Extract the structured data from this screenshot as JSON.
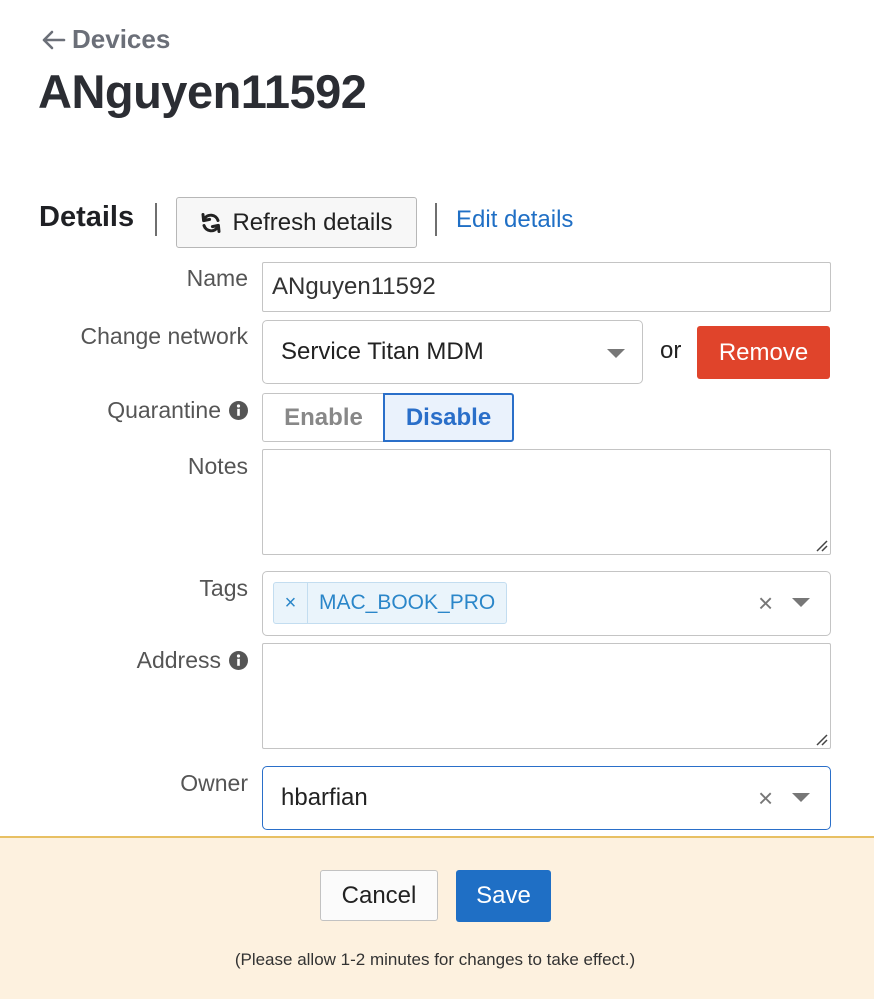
{
  "header": {
    "back_label": "Devices",
    "title": "ANguyen11592"
  },
  "details": {
    "section_title": "Details",
    "refresh_label": "Refresh details",
    "edit_label": "Edit details"
  },
  "form": {
    "name": {
      "label": "Name",
      "value": "ANguyen11592"
    },
    "network": {
      "label": "Change network",
      "value": "Service Titan MDM",
      "or_text": "or",
      "remove_label": "Remove"
    },
    "quarantine": {
      "label": "Quarantine",
      "enable_label": "Enable",
      "disable_label": "Disable",
      "selected": "Disable"
    },
    "notes": {
      "label": "Notes",
      "value": ""
    },
    "tags": {
      "label": "Tags",
      "items": [
        "MAC_BOOK_PRO"
      ],
      "remove_glyph": "×",
      "clear_glyph": "×"
    },
    "address": {
      "label": "Address",
      "value": ""
    },
    "owner": {
      "label": "Owner",
      "value": "hbarfian",
      "clear_glyph": "×"
    }
  },
  "footer": {
    "cancel_label": "Cancel",
    "save_label": "Save",
    "note": "(Please allow 1-2 minutes for changes to take effect.)"
  },
  "colors": {
    "accent": "#1f6fc5",
    "danger": "#e0442b",
    "footer_bg": "#fdf1df",
    "tag_text": "#2a86c9"
  },
  "icons": [
    "arrow-left-icon",
    "refresh-icon",
    "info-icon",
    "caret-down-icon",
    "close-icon",
    "resize-grip-icon"
  ]
}
